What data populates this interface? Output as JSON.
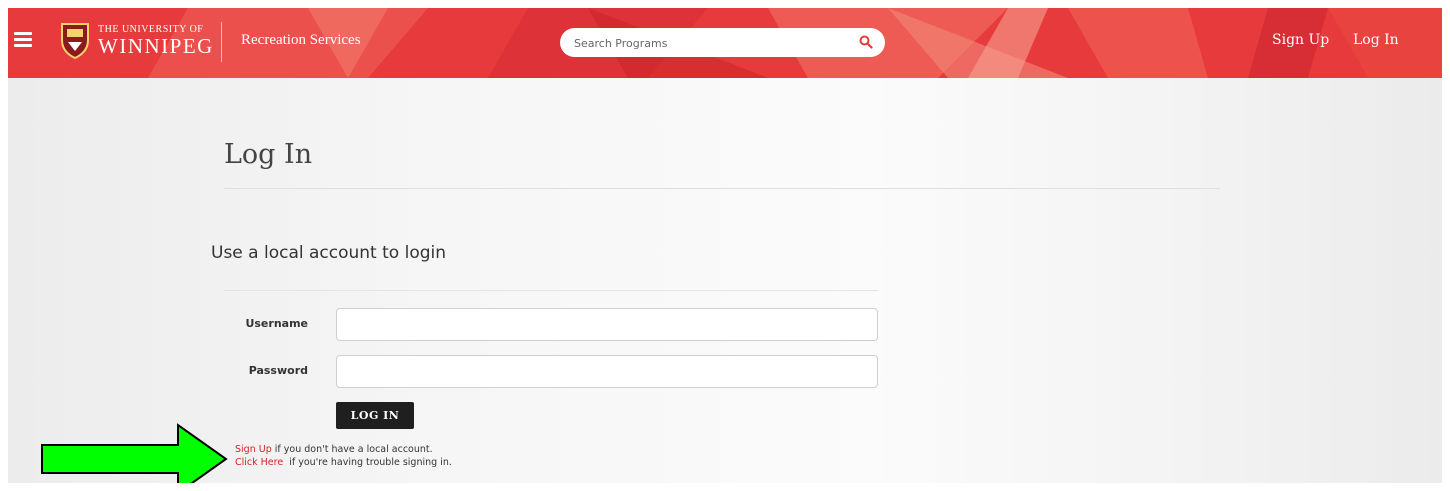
{
  "header": {
    "university_small": "THE UNIVERSITY OF",
    "university_big": "WINNIPEG",
    "department": "Recreation Services",
    "search_placeholder": "Search Programs",
    "nav": {
      "sign_up": "Sign Up",
      "log_in": "Log In"
    },
    "brand_color": "#e63a3c"
  },
  "main": {
    "title": "Log In",
    "section_heading": "Use a local account to login",
    "form": {
      "username_label": "Username",
      "username_value": "",
      "password_label": "Password",
      "password_value": "",
      "submit_label": "LOG IN"
    },
    "help": {
      "signup_link": "Sign Up",
      "signup_text": " if you don't have a local account.",
      "trouble_link": "Click Here",
      "trouble_text": "  if you're having trouble signing in."
    },
    "link_color": "#d4232b"
  },
  "annotation": {
    "arrow_color": "#00ff00",
    "icon": "right-arrow-icon"
  }
}
